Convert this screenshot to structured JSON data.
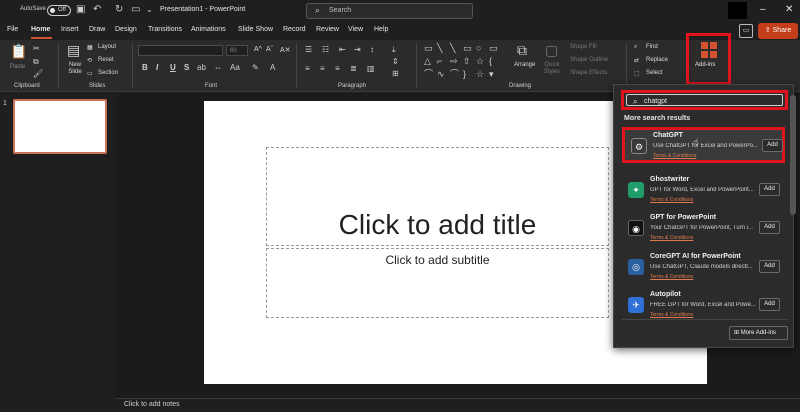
{
  "titlebar": {
    "autosave_label": "AutoSave",
    "autosave_state": "Off",
    "doc_title": "Presentation1 - PowerPoint",
    "search_placeholder": "Search"
  },
  "tabs": [
    "File",
    "Home",
    "Insert",
    "Draw",
    "Design",
    "Transitions",
    "Animations",
    "Slide Show",
    "Record",
    "Review",
    "View",
    "Help"
  ],
  "active_tab": "Home",
  "share_label": "Share",
  "ribbon": {
    "clipboard": {
      "paste": "Paste",
      "label": "Clipboard"
    },
    "slides": {
      "new_slide": "New Slide",
      "layout": "Layout",
      "reset": "Reset",
      "section": "Section",
      "label": "Slides"
    },
    "font": {
      "label": "Font",
      "size": "60",
      "bold": "B",
      "italic": "I",
      "underline": "U",
      "strike": "S"
    },
    "paragraph": {
      "label": "Paragraph"
    },
    "drawing": {
      "arrange": "Arrange",
      "quick_styles": "Quick Styles",
      "shape_fill": "Shape Fill",
      "shape_outline": "Shape Outline",
      "shape_effects": "Shape Effects",
      "label": "Drawing"
    },
    "editing": {
      "find": "Find",
      "replace": "Replace",
      "select": "Select"
    },
    "addins": {
      "label": "Add-ins"
    }
  },
  "slide": {
    "title_placeholder": "Click to add title",
    "subtitle_placeholder": "Click to add subtitle",
    "thumb_number": "1"
  },
  "notes_placeholder": "Click to add notes",
  "addins_panel": {
    "search_value": "chatgpt",
    "section_title": "More search results",
    "items": [
      {
        "name": "ChatGPT",
        "desc": "Use ChatGPT for Excel and PowerPo...",
        "terms": "Terms & Conditions",
        "add": "Add",
        "color": "#3a3a3a",
        "icon": "openai-icon"
      },
      {
        "name": "Ghostwriter",
        "desc": "GPT for Word, Excel and PowerPoint...",
        "terms": "Terms & Conditions",
        "add": "Add",
        "color": "#1f9d6b",
        "icon": "ghostwriter-icon"
      },
      {
        "name": "GPT for PowerPoint",
        "desc": "Your ChatGPT for PowerPoint, Turn i...",
        "terms": "Terms & Conditions",
        "add": "Add",
        "color": "#111111",
        "icon": "gpt-ppt-icon"
      },
      {
        "name": "CoreGPT AI for PowerPoint",
        "desc": "Use ChatGPT, Claude models directl...",
        "terms": "Terms & Conditions",
        "add": "Add",
        "color": "#2a5fa0",
        "icon": "coregpt-icon"
      },
      {
        "name": "Autopilot",
        "desc": "FREE GPT for Word, Excel and Powe...",
        "terms": "Terms & Conditions",
        "add": "Add",
        "color": "#2f6fd6",
        "icon": "autopilot-icon"
      }
    ],
    "more_addins": "More Add-ins"
  },
  "colors": {
    "accent": "#d35230",
    "share": "#c43e1c",
    "highlight": "#e0141c"
  }
}
